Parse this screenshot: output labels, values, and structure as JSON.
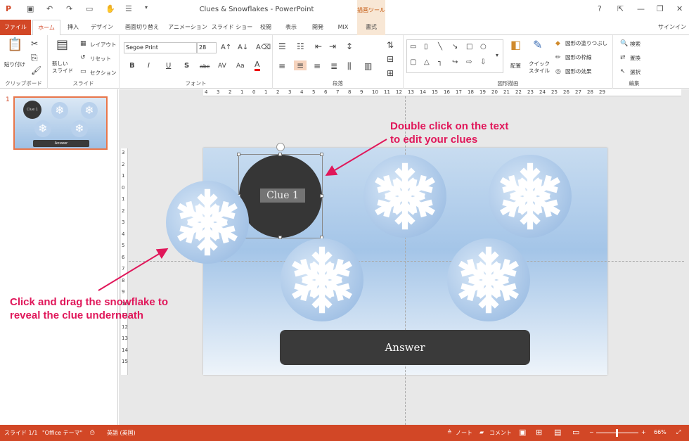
{
  "titlebar": {
    "app_icon": "powerpoint-icon",
    "title": "Clues & Snowflakes - PowerPoint",
    "context_tab": "描画ツール",
    "help": "?",
    "minimize": "—",
    "restore": "❐",
    "close": "✕"
  },
  "tabs": [
    "ファイル",
    "ホーム",
    "挿入",
    "デザイン",
    "画面切り替え",
    "アニメーション",
    "スライド ショー",
    "校閲",
    "表示",
    "開発",
    "MIX",
    "書式"
  ],
  "signin": "サインイン",
  "ribbon": {
    "clipboard": {
      "label": "クリップボード",
      "paste": "貼り付け"
    },
    "slides": {
      "label": "スライド",
      "new_slide": "新しい\nスライド",
      "layout": "レイアウト",
      "reset": "リセット",
      "section": "セクション"
    },
    "font": {
      "label": "フォント",
      "font_name": "Segoe Print",
      "font_size": "28",
      "bold": "B",
      "italic": "I",
      "underline": "U",
      "shadow": "S",
      "strike": "abc",
      "spacing": "AV",
      "case": "Aa",
      "color": "A"
    },
    "paragraph": {
      "label": "段落"
    },
    "drawing": {
      "label": "図形描画",
      "arrange": "配置",
      "quick_styles": "クイック\nスタイル",
      "fill": "図形の塗りつぶし",
      "outline": "図形の枠線",
      "effects": "図形の効果"
    },
    "editing": {
      "label": "編集",
      "find": "検索",
      "replace": "置換",
      "select": "選択"
    }
  },
  "slide_panel": {
    "number": "1",
    "thumb_clue": "Clue 1",
    "thumb_answer": "Answer"
  },
  "ruler": {
    "h_ticks": [
      "4",
      "3",
      "2",
      "1",
      "0",
      "1",
      "2",
      "3",
      "4",
      "5",
      "6",
      "7",
      "8",
      "9",
      "10",
      "11",
      "12",
      "13",
      "14",
      "15",
      "16",
      "17",
      "18",
      "19",
      "20",
      "21",
      "22",
      "23",
      "24",
      "25",
      "26",
      "27",
      "28",
      "29"
    ],
    "v_ticks": [
      "3",
      "2",
      "1",
      "0",
      "1",
      "2",
      "3",
      "4",
      "5",
      "6",
      "7",
      "8",
      "9",
      "10",
      "11",
      "12",
      "13",
      "14",
      "15"
    ]
  },
  "slide": {
    "clue_text": "Clue 1",
    "answer_text": "Answer"
  },
  "annotations": {
    "double_click_line1": "Double click on the text",
    "double_click_line2": "to edit your clues",
    "drag_line1": "Click and drag the snowflake to",
    "drag_line2": "reveal the clue underneath"
  },
  "status": {
    "slide_count": "スライド 1/1",
    "theme": "\"Office テーマ\"",
    "language": "英語 (英国)",
    "notes": "ノート",
    "comments": "コメント",
    "zoom": "66%"
  },
  "colors": {
    "accent": "#d24726",
    "annotation": "#e0175a",
    "clue_fill": "#363636"
  }
}
